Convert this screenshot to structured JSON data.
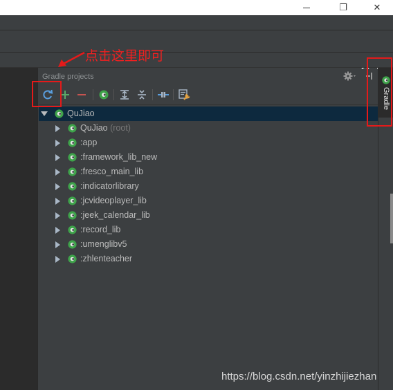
{
  "window": {
    "controls": [
      "minimize",
      "restore",
      "close"
    ],
    "restore_glyph": "❐",
    "close_glyph": "✕"
  },
  "gradle_panel": {
    "title": "Gradle projects",
    "tab_label": "Gradle",
    "toolbar": [
      {
        "name": "refresh-all-projects",
        "icon": "refresh-icon"
      },
      {
        "name": "link-gradle-project",
        "icon": "plus-icon"
      },
      {
        "name": "detach-gradle-project",
        "icon": "minus-icon"
      },
      {
        "name": "execute-gradle-task",
        "icon": "gradle-icon"
      },
      {
        "name": "expand-all",
        "icon": "expand-all-icon"
      },
      {
        "name": "collapse-all",
        "icon": "collapse-all-icon"
      },
      {
        "name": "toggle-offline-mode",
        "icon": "offline-icon"
      },
      {
        "name": "gradle-settings",
        "icon": "settings-wrench-icon"
      }
    ],
    "tree": {
      "root": {
        "label": "QuJiao",
        "expanded": true,
        "selected": true
      },
      "children": [
        {
          "label": "QuJiao",
          "suffix": "(root)"
        },
        {
          "label": ":app",
          "suffix": ""
        },
        {
          "label": ":framework_lib_new",
          "suffix": ""
        },
        {
          "label": ":fresco_main_lib",
          "suffix": ""
        },
        {
          "label": ":indicatorlibrary",
          "suffix": ""
        },
        {
          "label": ":jcvideoplayer_lib",
          "suffix": ""
        },
        {
          "label": ":jeek_calendar_lib",
          "suffix": ""
        },
        {
          "label": ":record_lib",
          "suffix": ""
        },
        {
          "label": ":umenglibv5",
          "suffix": ""
        },
        {
          "label": ":zhlenteacher",
          "suffix": ""
        }
      ]
    }
  },
  "annotation": {
    "callout_text": "点击这里即可",
    "color": "#e51a1a"
  },
  "watermark": "https://blog.csdn.net/yinzhijiezhan",
  "colors": {
    "panel_bg": "#3c3f41",
    "selected_row": "#0d293e",
    "gradle_green": "#3ea34a",
    "refresh_blue": "#4a90d9"
  }
}
